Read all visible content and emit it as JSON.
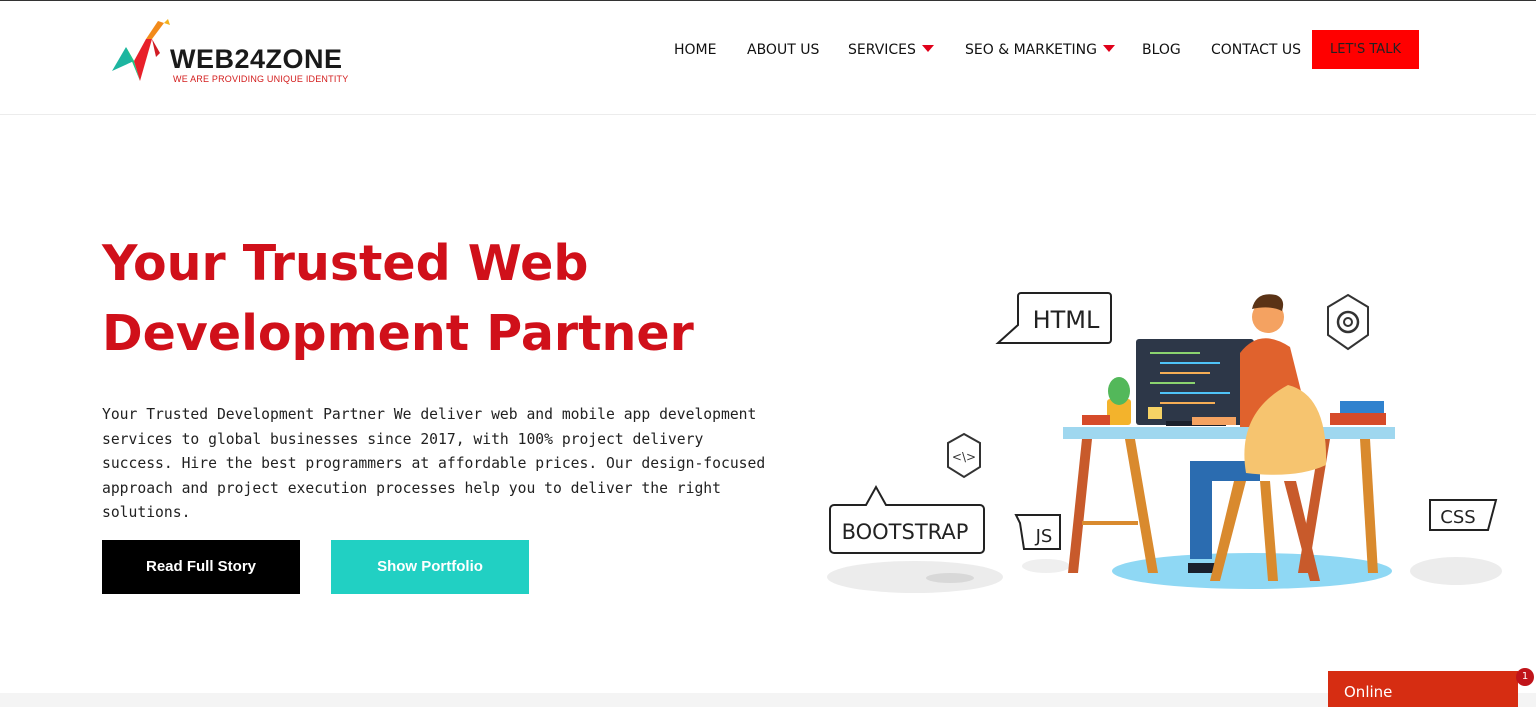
{
  "brand": {
    "name": "WEB24ZONE",
    "tagline": "WE ARE PROVIDING UNIQUE IDENTITY"
  },
  "nav": {
    "items": [
      {
        "label": "HOME",
        "has_dropdown": false
      },
      {
        "label": "ABOUT US",
        "has_dropdown": false
      },
      {
        "label": "SERVICES",
        "has_dropdown": true
      },
      {
        "label": "SEO & MARKETING",
        "has_dropdown": true
      },
      {
        "label": "BLOG",
        "has_dropdown": false
      },
      {
        "label": "CONTACT US",
        "has_dropdown": false
      }
    ],
    "cta_label": "LET'S TALK"
  },
  "hero": {
    "title": "Your Trusted Web Development Partner",
    "description": "Your Trusted Development Partner We deliver web and mobile app development services to global businesses since 2017, with 100% project delivery success. Hire the best programmers at affordable prices. Our design-focused approach and project execution processes help you to deliver the right solutions.",
    "primary_button": "Read Full Story",
    "secondary_button": "Show Portfolio"
  },
  "illustration": {
    "labels": [
      "HTML",
      "BOOTSTRAP",
      "JS",
      "CSS",
      "<\\>"
    ],
    "icons": [
      "gear-icon",
      "code-icon",
      "developer-at-desk"
    ]
  },
  "chat": {
    "status": "Online",
    "badge_count": "1"
  },
  "colors": {
    "accent_red": "#d0101a",
    "cta_red": "#ff0000",
    "teal": "#21d0c3",
    "chat_red": "#d62d12"
  }
}
